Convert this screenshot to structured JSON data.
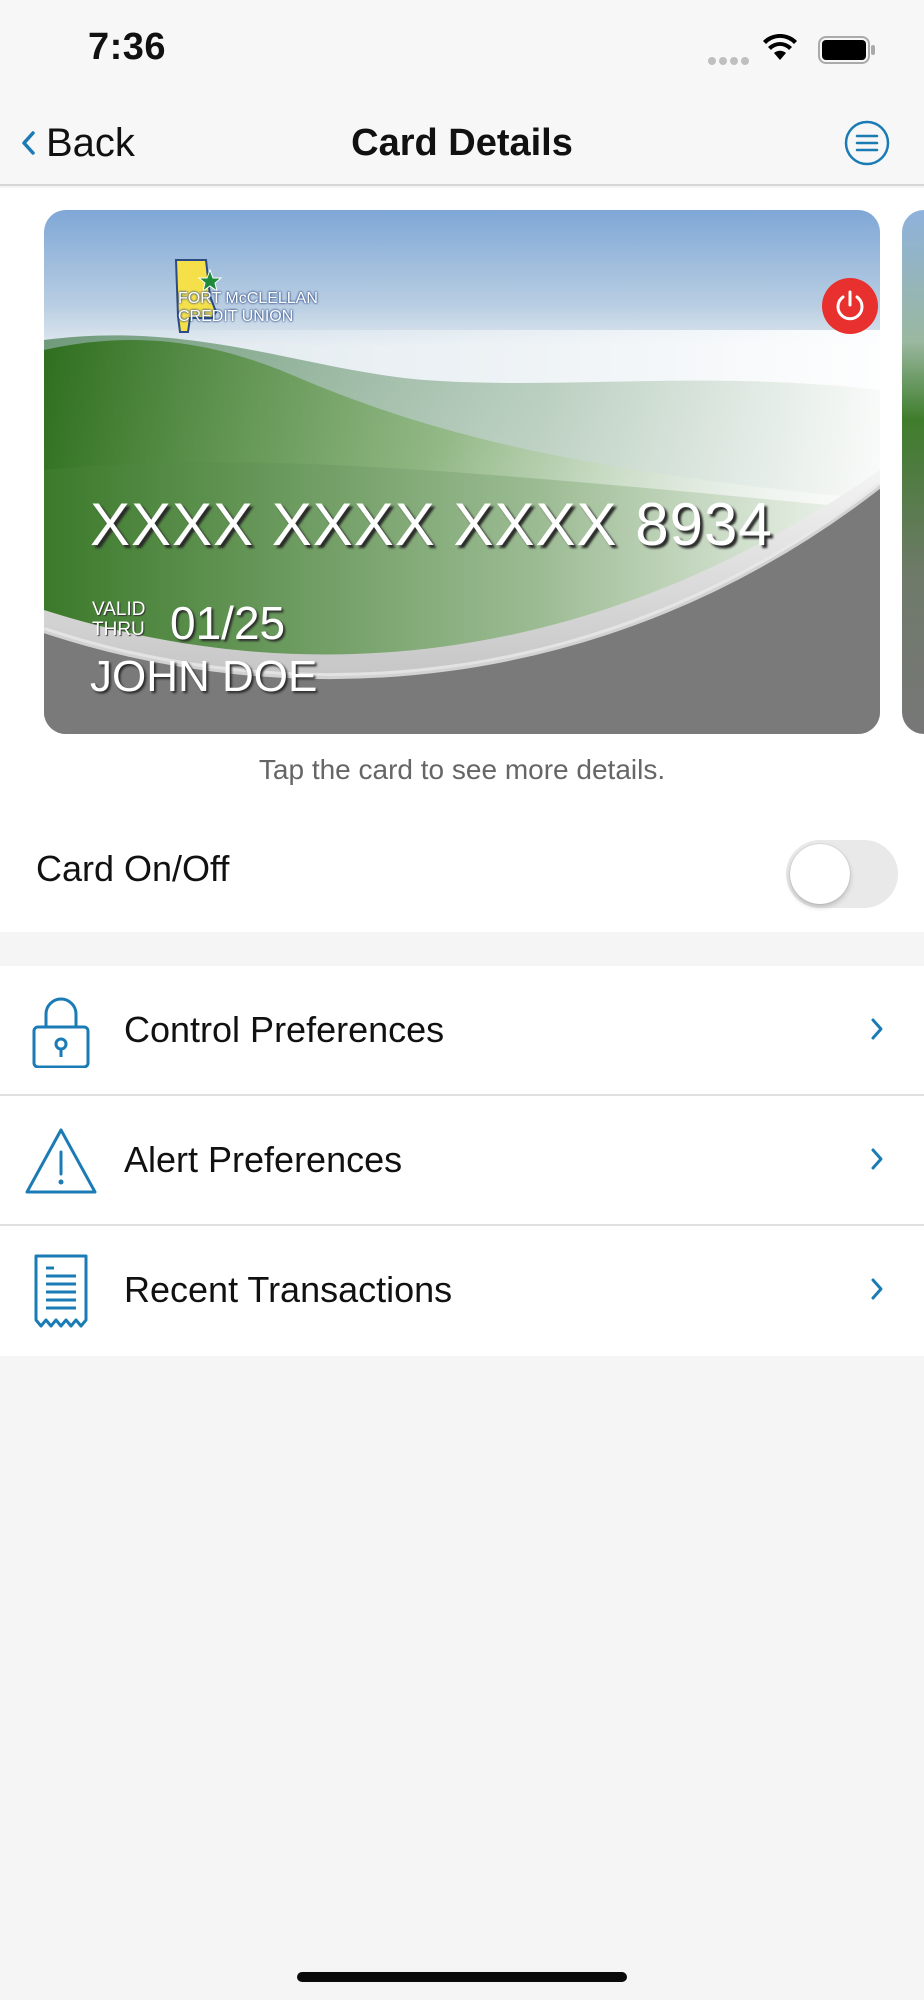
{
  "status_bar": {
    "time": "7:36"
  },
  "nav": {
    "back_label": "Back",
    "title": "Card Details"
  },
  "card": {
    "issuer_line1": "FORT McCLELLAN",
    "issuer_line2": "CREDIT UNION",
    "number": "XXXX XXXX XXXX 8934",
    "valid_label_1": "VALID",
    "valid_label_2": "THRU",
    "expiry": "01/25",
    "cardholder": "JOHN DOE",
    "hint": "Tap the card to see more details."
  },
  "card_toggle": {
    "label": "Card On/Off",
    "on": false
  },
  "menu": [
    {
      "label": "Control Preferences",
      "icon": "lock-icon"
    },
    {
      "label": "Alert Preferences",
      "icon": "warning-icon"
    },
    {
      "label": "Recent Transactions",
      "icon": "receipt-icon"
    }
  ],
  "colors": {
    "accent": "#1a7bb5",
    "power": "#e8302e",
    "toggle_off": "#e9e9ea"
  }
}
